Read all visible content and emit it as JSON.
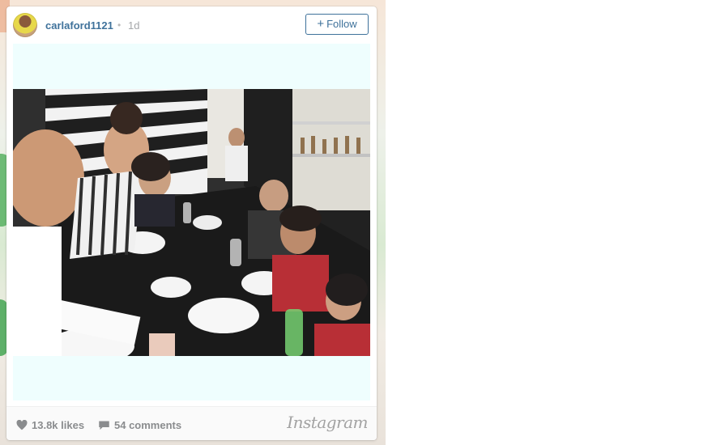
{
  "post": {
    "username": "carlaford1121",
    "separator": "•",
    "time": "1d",
    "follow_label": "Follow",
    "follow_plus": "+",
    "likes": "13.8k likes",
    "comments": "54 comments",
    "brand": "Instagram"
  },
  "colors": {
    "link_blue": "#3f729b",
    "media_bg": "#effefe",
    "footer_text": "#8a8c8e"
  },
  "icons": {
    "likes": "heart-icon",
    "comments": "speech-bubble-icon",
    "follow": "plus-icon"
  }
}
